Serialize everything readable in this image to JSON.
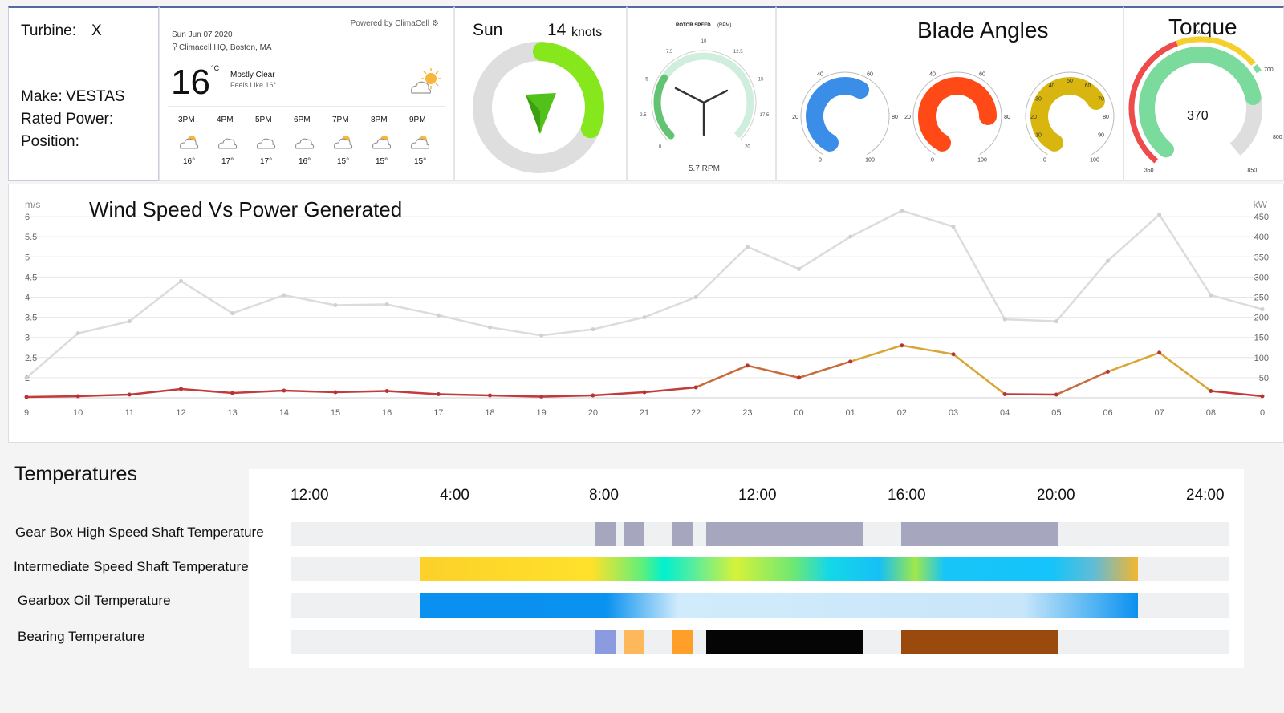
{
  "turbine": {
    "turbine_label": "Turbine:",
    "turbine_value": "X",
    "make_label": "Make:",
    "make_value": "VESTAS",
    "rated_power_label": "Rated Power:",
    "position_label": "Position:"
  },
  "weather": {
    "powered_by": "Powered by ClimaCell",
    "date": "Sun Jun 07 2020",
    "location": "Climacell HQ, Boston, MA",
    "temp": "16",
    "unit": "°C",
    "condition": "Mostly Clear",
    "feels_like": "Feels Like 16°",
    "hours": [
      {
        "time": "3PM",
        "temp": "16°",
        "icon": "sun-cloud-icon"
      },
      {
        "time": "4PM",
        "temp": "17°",
        "icon": "cloud-icon"
      },
      {
        "time": "5PM",
        "temp": "17°",
        "icon": "cloud-icon"
      },
      {
        "time": "6PM",
        "temp": "16°",
        "icon": "cloud-icon"
      },
      {
        "time": "7PM",
        "temp": "15°",
        "icon": "sun-cloud-icon"
      },
      {
        "time": "8PM",
        "temp": "15°",
        "icon": "sun-cloud-icon"
      },
      {
        "time": "9PM",
        "temp": "15°",
        "icon": "sun-cloud-icon"
      }
    ]
  },
  "wind": {
    "day": "Sun",
    "speed": "14",
    "unit": "knots",
    "fill_fraction": 0.3
  },
  "rotor": {
    "title": "ROTOR SPEED",
    "unit": "(RPM)",
    "ticks": [
      "0",
      "2.5",
      "5",
      "7.5",
      "10",
      "12.5",
      "15",
      "17.5",
      "20"
    ],
    "value_text": "5.7 RPM",
    "value": 5.7,
    "max": 20
  },
  "blades": {
    "title": "Blade Angles",
    "gauges": [
      {
        "color": "#3b8ee8",
        "value": 60,
        "max": 100,
        "ticks": [
          "0",
          "20",
          "40",
          "60",
          "80",
          "100"
        ]
      },
      {
        "color": "#ff4a17",
        "value": 80,
        "max": 100,
        "ticks": [
          "0",
          "20",
          "40",
          "60",
          "80",
          "100"
        ]
      },
      {
        "color": "#d9b60f",
        "value": 70,
        "max": 100,
        "ticks": [
          "0",
          "10",
          "20",
          "30",
          "40",
          "50",
          "60",
          "70",
          "80",
          "90",
          "100"
        ]
      }
    ]
  },
  "torque": {
    "title": "Torque",
    "value": "370",
    "ticks": [
      "350",
      "600",
      "700",
      "800",
      "850"
    ]
  },
  "chart_data": {
    "type": "line",
    "title": "Wind Speed Vs Power Generated",
    "y_left_unit": "m/s",
    "y_right_unit": "kW",
    "left_ticks": [
      "2",
      "2.5",
      "3",
      "3.5",
      "4",
      "4.5",
      "5",
      "5.5",
      "6"
    ],
    "right_ticks": [
      "50",
      "100",
      "150",
      "200",
      "250",
      "300",
      "350",
      "400",
      "450"
    ],
    "ylim_left": [
      1.5,
      6.4
    ],
    "ylim_right": [
      0,
      490
    ],
    "x": [
      "9",
      "10",
      "11",
      "12",
      "13",
      "14",
      "15",
      "16",
      "17",
      "18",
      "19",
      "20",
      "21",
      "22",
      "23",
      "00",
      "01",
      "02",
      "03",
      "04",
      "05",
      "06",
      "07",
      "08",
      "0"
    ],
    "series": [
      {
        "axis": "left",
        "color": "#dcdcdc",
        "values": [
          2.0,
          3.1,
          3.4,
          4.4,
          3.6,
          4.05,
          3.8,
          3.82,
          3.55,
          3.25,
          3.05,
          3.2,
          3.5,
          4.0,
          5.25,
          4.7,
          5.5,
          6.15,
          5.75,
          3.45,
          3.4,
          4.9,
          6.05,
          4.05,
          3.7
        ]
      },
      {
        "axis": "right",
        "color": "#c23a3a",
        "values": [
          2,
          4,
          8,
          22,
          12,
          18,
          14,
          17,
          9,
          6,
          3,
          6,
          14,
          26,
          80,
          50,
          90,
          130,
          108,
          9,
          8,
          65,
          112,
          17,
          4
        ]
      }
    ]
  },
  "temperatures": {
    "title": "Temperatures",
    "ticks": [
      "12:00",
      "4:00",
      "8:00",
      "12:00",
      "16:00",
      "20:00",
      "24:00"
    ],
    "rows": [
      {
        "label": "Gear Box High Speed Shaft Temperature"
      },
      {
        "label": "Intermediate Speed Shaft Temperature"
      },
      {
        "label": "Gearbox Oil Temperature"
      },
      {
        "label": "Bearing Temperature"
      }
    ]
  }
}
